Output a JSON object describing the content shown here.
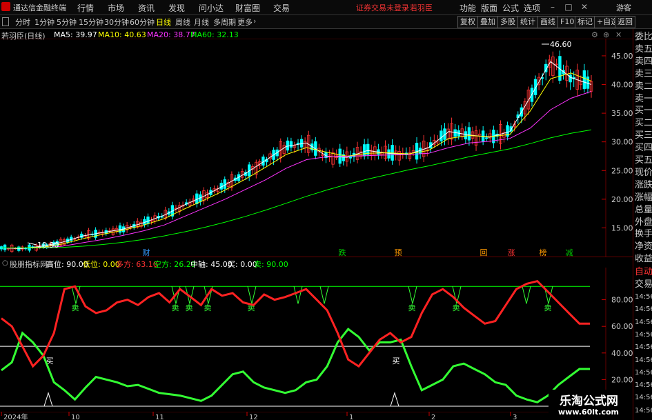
{
  "app": {
    "title": "通达信金融终端",
    "login_status": "证券交易未登录",
    "stock_name": "若羽臣",
    "user": "游客"
  },
  "menu": [
    "行情",
    "市场",
    "资讯",
    "发现",
    "问小达",
    "财富圈",
    "交易"
  ],
  "right_menu": [
    "功能",
    "版面",
    "公式",
    "选项"
  ],
  "timeframes": [
    "分时",
    "1分钟",
    "5分钟",
    "15分钟",
    "30分钟",
    "60分钟",
    "日线",
    "周线",
    "月线",
    "多周期",
    "更多"
  ],
  "active_timeframe": "日线",
  "tool_buttons": [
    "复权",
    "叠加",
    "多股",
    "统计",
    "画线",
    "F10",
    "标记",
    "+自选",
    "返回"
  ],
  "main_chart": {
    "name": "若羽臣(日线)",
    "ma": [
      {
        "label": "MA5: 39.97",
        "color": "#ffffff"
      },
      {
        "label": "MA10: 40.63",
        "color": "#ffff00"
      },
      {
        "label": "MA20: 38.77",
        "color": "#ff33ff"
      },
      {
        "label": "MA60: 32.13",
        "color": "#00ff00"
      }
    ],
    "y_ticks": [
      "45.00",
      "40.00",
      "35.00",
      "30.00",
      "25.00",
      "20.00",
      "15.00"
    ],
    "high_label": "46.60",
    "low_label": "10.90",
    "event_tags": [
      {
        "text": "财",
        "color": "#3399ff"
      },
      {
        "text": "跌",
        "color": "#00cc00"
      },
      {
        "text": "预",
        "color": "#ff9900"
      },
      {
        "text": "回",
        "color": "#ff9900"
      },
      {
        "text": "涨",
        "color": "#ff3333"
      },
      {
        "text": "榜",
        "color": "#ff9900"
      },
      {
        "text": "减",
        "color": "#00cc00"
      }
    ]
  },
  "chart_data": {
    "type": "line",
    "x_ticks": [
      "2024年",
      "10",
      "11",
      "12",
      "1",
      "2",
      "3"
    ],
    "series": [
      {
        "name": "MA5",
        "values": [
          11.5,
          11.4,
          11.8,
          12.5,
          13.6,
          14.2,
          14.8,
          15.9,
          17.2,
          19.0,
          20.6,
          22.5,
          24.5,
          26.8,
          29.2,
          29.8,
          27.5,
          27.3,
          28.5,
          28.0,
          27.8,
          29.0,
          31.8,
          31.2,
          30.8,
          31.8,
          37.8,
          44.0,
          41.2,
          40.0
        ]
      },
      {
        "name": "MA10",
        "values": [
          11.5,
          11.5,
          11.6,
          12.2,
          13.1,
          13.9,
          14.6,
          15.5,
          16.6,
          18.3,
          19.9,
          21.6,
          23.5,
          25.6,
          27.8,
          29.0,
          28.2,
          27.5,
          28.0,
          28.1,
          27.9,
          28.5,
          30.6,
          31.1,
          30.9,
          31.3,
          35.4,
          41.0,
          42.0,
          40.6
        ]
      },
      {
        "name": "MA20",
        "values": [
          11.5,
          11.5,
          11.5,
          11.8,
          12.4,
          13.0,
          13.7,
          14.5,
          15.5,
          17.0,
          18.5,
          20.0,
          21.7,
          23.4,
          25.4,
          26.9,
          27.4,
          27.5,
          27.6,
          27.7,
          27.8,
          28.0,
          29.0,
          29.8,
          30.1,
          30.6,
          32.4,
          35.6,
          37.6,
          38.8
        ]
      },
      {
        "name": "MA60",
        "values": [
          11.5,
          11.5,
          11.5,
          11.6,
          11.8,
          12.1,
          12.5,
          13.0,
          13.6,
          14.3,
          15.1,
          16.0,
          17.0,
          18.1,
          19.3,
          20.5,
          21.6,
          22.6,
          23.5,
          24.3,
          25.1,
          25.8,
          26.6,
          27.4,
          28.1,
          28.8,
          29.7,
          30.7,
          31.5,
          32.1
        ]
      }
    ],
    "ylim": [
      10,
      48
    ]
  },
  "indicator": {
    "title": "股朋指标网",
    "values": [
      {
        "label": "高位: 90.00",
        "color": "#ffffff"
      },
      {
        "label": "低位: 0.00",
        "color": "#ffff00"
      },
      {
        "label": "多方: 63.10",
        "color": "#ff3333"
      },
      {
        "label": "空方: 26.29",
        "color": "#00ff00"
      },
      {
        "label": "中轴: 45.00",
        "color": "#ffffff"
      },
      {
        "label": "买: 0.00",
        "color": "#ffffff"
      },
      {
        "label": "卖: 90.00",
        "color": "#00ff00"
      }
    ],
    "y_ticks": [
      "80.00",
      "60.00",
      "40.00",
      "20.00"
    ],
    "sell_label": "卖",
    "buy_label": "买",
    "duofang": [
      66,
      60,
      45,
      30,
      38,
      55,
      88,
      90,
      75,
      70,
      72,
      78,
      80,
      76,
      82,
      85,
      78,
      88,
      82,
      76,
      88,
      83,
      85,
      78,
      76,
      84,
      80,
      82,
      85,
      88,
      80,
      72,
      55,
      35,
      30,
      40,
      50,
      55,
      48,
      52,
      70,
      84,
      88,
      82,
      74,
      68,
      62,
      64,
      76,
      88,
      92,
      94,
      86,
      78,
      70,
      62,
      62
    ],
    "kongfang": [
      27,
      33,
      55,
      48,
      38,
      18,
      12,
      5,
      14,
      22,
      20,
      18,
      15,
      16,
      13,
      10,
      9,
      8,
      6,
      4,
      8,
      16,
      24,
      26,
      18,
      14,
      12,
      10,
      12,
      18,
      20,
      30,
      48,
      58,
      52,
      42,
      48,
      48,
      50,
      30,
      12,
      16,
      20,
      30,
      32,
      28,
      24,
      18,
      16,
      8,
      5,
      3,
      8,
      16,
      22,
      28,
      28
    ]
  },
  "watermark": {
    "text": "乐淘公式网",
    "url": "www.60lt.com"
  },
  "right_panel": {
    "labels": [
      "委比",
      "卖五",
      "卖四",
      "卖三",
      "卖二",
      "卖一",
      "买一",
      "买二",
      "买三",
      "买四",
      "买五",
      "现价",
      "涨跌",
      "涨幅",
      "总量",
      "外盘",
      "换手",
      "净资",
      "收益"
    ],
    "tabs": [
      "自动",
      "交易"
    ],
    "times": [
      "14:56",
      "14:56",
      "14:56",
      "14:56",
      "14:56",
      "14:56",
      "14:56",
      "14:56",
      "14:56",
      "14:56"
    ]
  }
}
